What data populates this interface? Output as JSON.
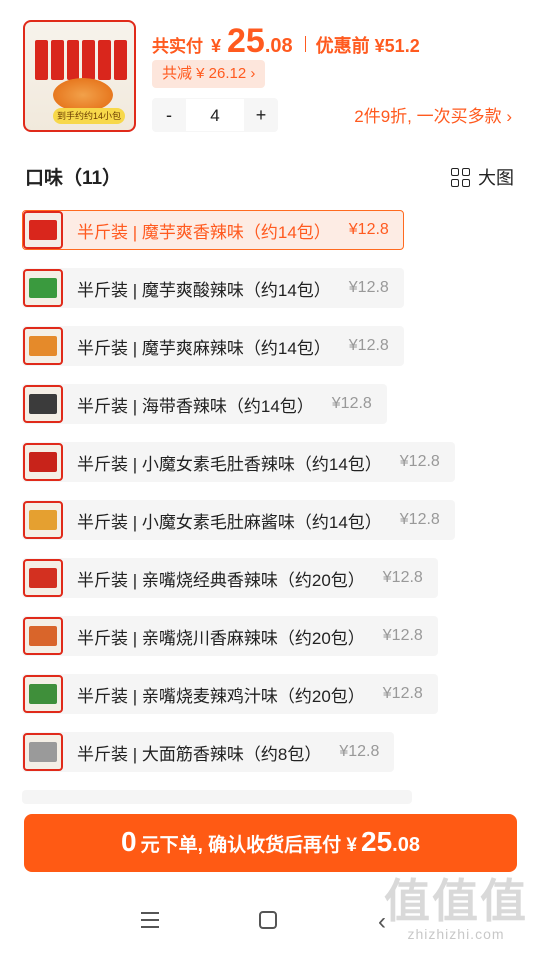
{
  "header": {
    "product_image_tag": "到手约约14小包",
    "pay_label": "共实付",
    "pay_currency": "¥",
    "pay_integer": "25",
    "pay_decimal": ".08",
    "pre_discount": "优惠前 ¥51.2",
    "saving": "共减 ¥ 26.12 ›",
    "quantity": "4",
    "minus": "-",
    "plus": "+",
    "promo": "2件9折, 一次买多款 ›"
  },
  "section": {
    "title": "口味（11）",
    "big_picture": "大图"
  },
  "options": [
    {
      "label": "半斤装 | 魔芋爽香辣味（约14包）",
      "price": "¥12.8",
      "selected": true,
      "color": "#d9261c"
    },
    {
      "label": "半斤装 | 魔芋爽酸辣味（约14包）",
      "price": "¥12.8",
      "selected": false,
      "color": "#3a9a3e"
    },
    {
      "label": "半斤装 | 魔芋爽麻辣味（约14包）",
      "price": "¥12.8",
      "selected": false,
      "color": "#e58a2a"
    },
    {
      "label": "半斤装 | 海带香辣味（约14包）",
      "price": "¥12.8",
      "selected": false,
      "color": "#3b3b3b"
    },
    {
      "label": "半斤装 | 小魔女素毛肚香辣味（约14包）",
      "price": "¥12.8",
      "selected": false,
      "color": "#c8231a"
    },
    {
      "label": "半斤装 | 小魔女素毛肚麻酱味（约14包）",
      "price": "¥12.8",
      "selected": false,
      "color": "#e5a030"
    },
    {
      "label": "半斤装 | 亲嘴烧经典香辣味（约20包）",
      "price": "¥12.8",
      "selected": false,
      "color": "#d33020"
    },
    {
      "label": "半斤装 | 亲嘴烧川香麻辣味（约20包）",
      "price": "¥12.8",
      "selected": false,
      "color": "#d9652a"
    },
    {
      "label": "半斤装 | 亲嘴烧麦辣鸡汁味（约20包）",
      "price": "¥12.8",
      "selected": false,
      "color": "#3f8f3a"
    },
    {
      "label": "半斤装 | 大面筋香辣味（约8包）",
      "price": "¥12.8",
      "selected": false,
      "color": "#9a9a9a"
    }
  ],
  "cta": {
    "part1": "0",
    "part2": "元下单, 确认收货后再付 ¥",
    "part3": "25",
    "part4": ".08"
  },
  "watermark": {
    "big": "值值值",
    "url": "zhizhizhi.com"
  },
  "colors": {
    "accent": "#ff5a1f",
    "button": "#ff5a14",
    "selected_bg": "#fdece4"
  }
}
